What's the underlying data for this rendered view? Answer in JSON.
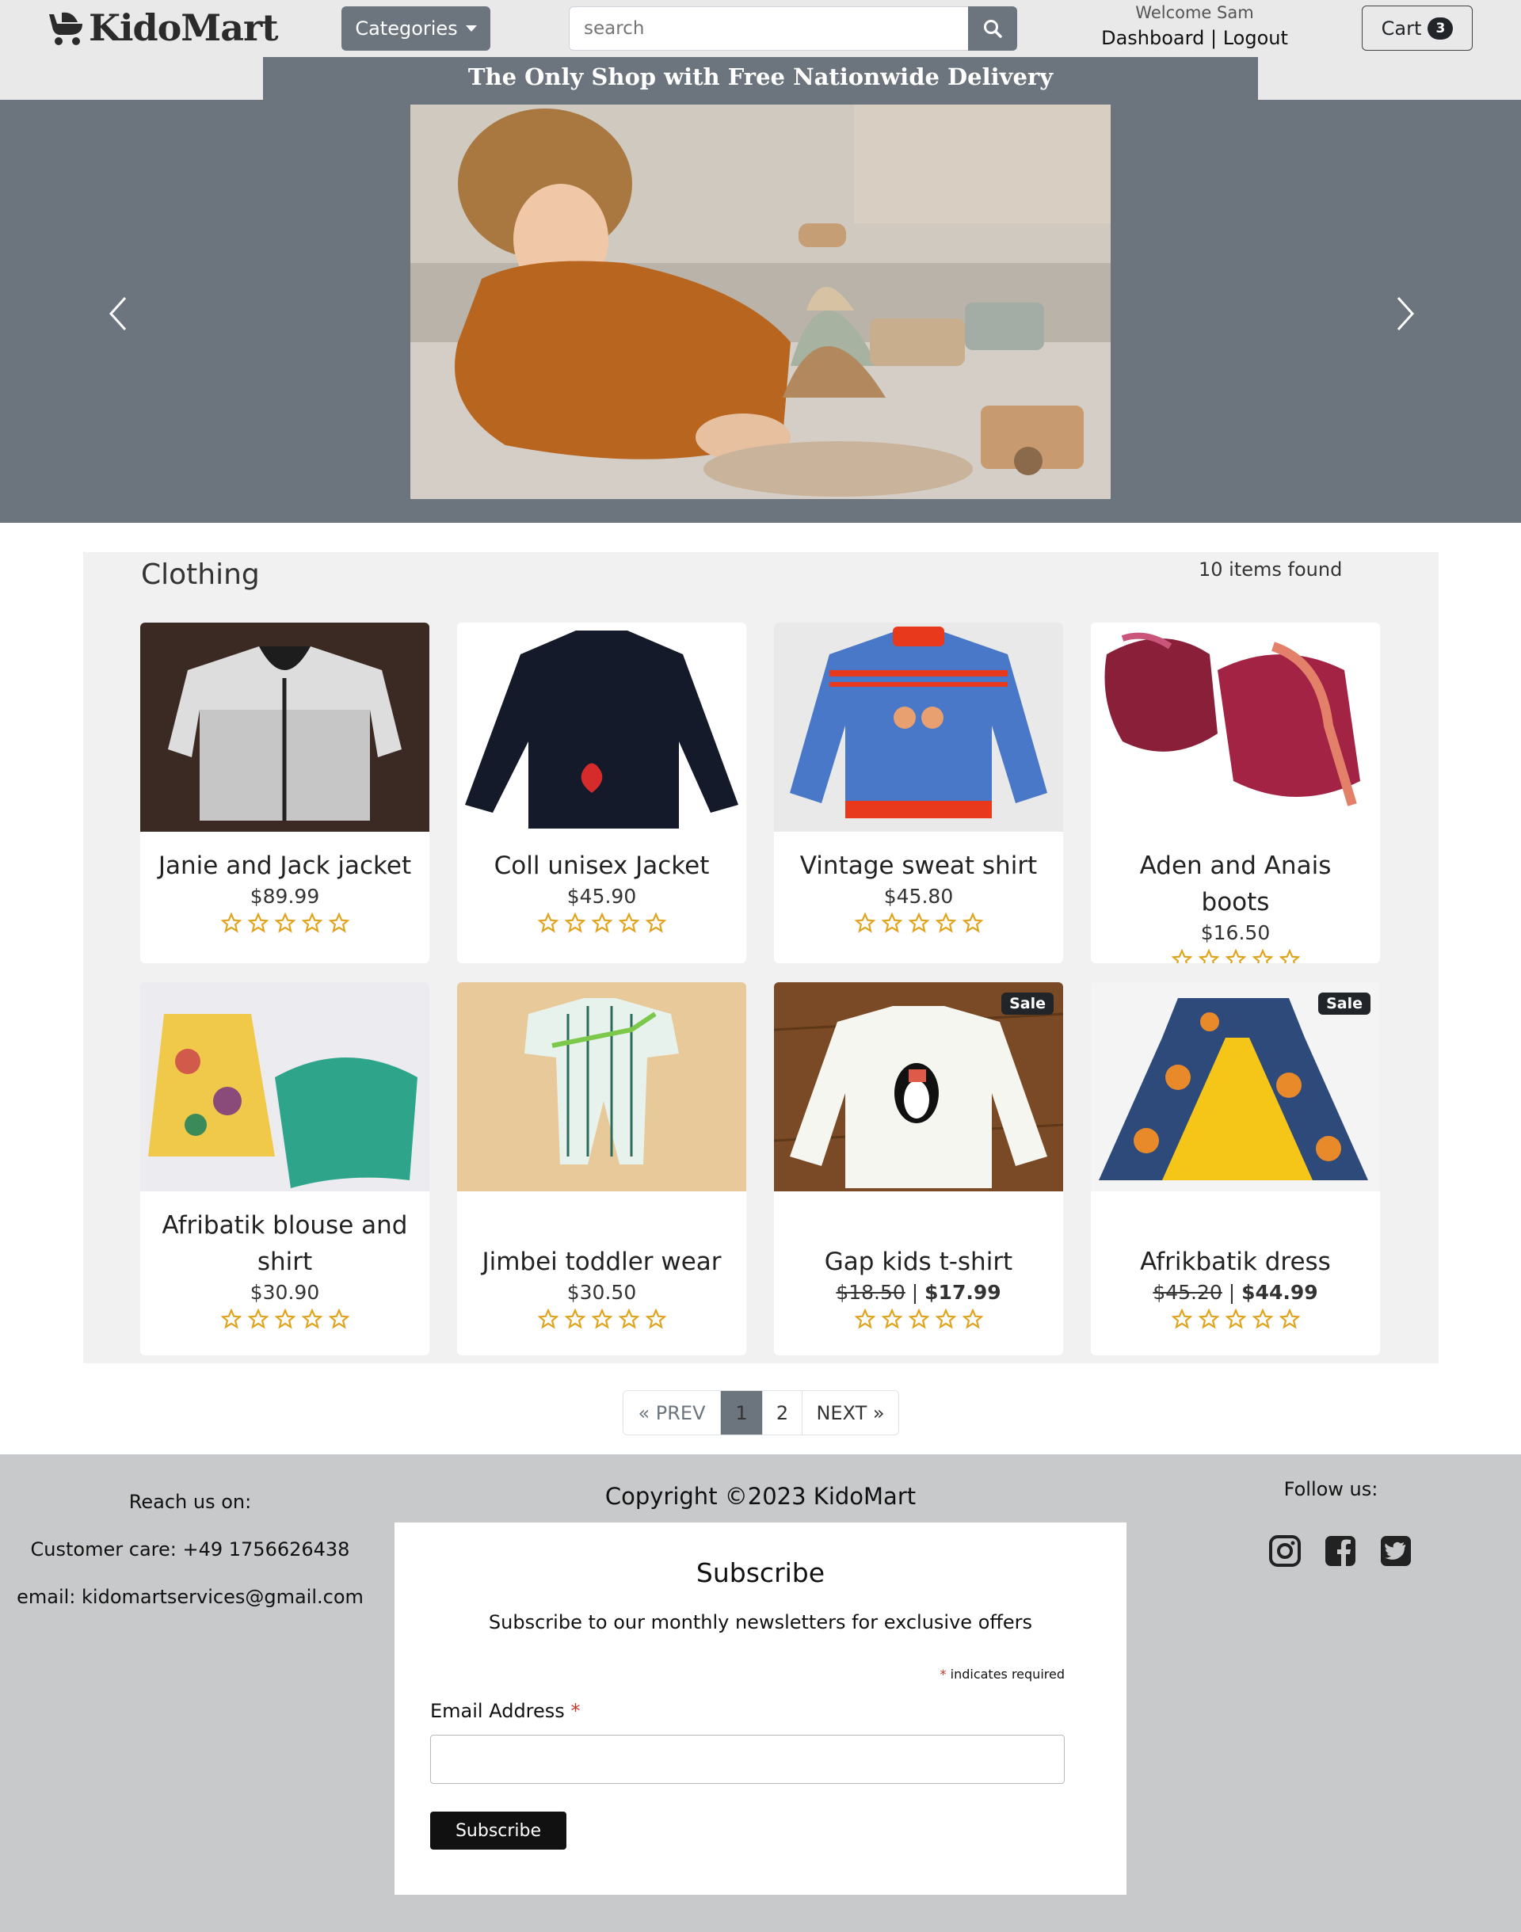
{
  "header": {
    "logo_text": "KidoMart",
    "categories_label": "Categories",
    "search_placeholder": "search",
    "welcome_text": "Welcome Sam",
    "dashboard_label": "Dashboard",
    "separator": "|",
    "logout_label": "Logout",
    "cart_label": "Cart",
    "cart_count": "3"
  },
  "banner": {
    "promo_text": "The Only Shop with Free Nationwide Delivery"
  },
  "section": {
    "title": "Clothing",
    "items_found": "10 items found"
  },
  "products": [
    {
      "name": "Janie and Jack jacket",
      "price": "$89.99",
      "old_price": "",
      "sale_price": "",
      "sale": false,
      "rating": 0
    },
    {
      "name": "Coll unisex Jacket",
      "price": "$45.90",
      "old_price": "",
      "sale_price": "",
      "sale": false,
      "rating": 0
    },
    {
      "name": "Vintage sweat shirt",
      "price": "$45.80",
      "old_price": "",
      "sale_price": "",
      "sale": false,
      "rating": 0
    },
    {
      "name": "Aden and Anais boots",
      "price": "$16.50",
      "old_price": "",
      "sale_price": "",
      "sale": false,
      "rating": 0
    },
    {
      "name": "Afribatik blouse and shirt",
      "price": "$30.90",
      "old_price": "",
      "sale_price": "",
      "sale": false,
      "rating": 0
    },
    {
      "name": "Jimbei toddler wear",
      "price": "$30.50",
      "old_price": "",
      "sale_price": "",
      "sale": false,
      "rating": 0
    },
    {
      "name": "Gap kids t-shirt",
      "price": "",
      "old_price": "$18.50",
      "sale_price": "$17.99",
      "sale": true,
      "rating": 0
    },
    {
      "name": "Afrikbatik dress",
      "price": "",
      "old_price": "$45.20",
      "sale_price": "$44.99",
      "sale": true,
      "rating": 0
    }
  ],
  "sale_badge": "Sale",
  "price_separator": " | ",
  "pagination": {
    "prev": "« PREV",
    "pages": [
      "1",
      "2"
    ],
    "current": "1",
    "next": "NEXT »"
  },
  "footer": {
    "reach_title": "Reach us on:",
    "customer_care": "Customer care: +49 1756626438",
    "email_label": "email:",
    "email": "kidomartservices@gmail.com",
    "copyright": "Copyright ©2023 KidoMart",
    "follow_title": "Follow us:",
    "social_icons": [
      "instagram-icon",
      "facebook-icon",
      "twitter-icon"
    ]
  },
  "subscribe": {
    "title": "Subscribe",
    "description": "Subscribe to our monthly newsletters for exclusive offers",
    "required_note": "indicates required",
    "email_label": "Email Address",
    "button_label": "Subscribe"
  },
  "colors": {
    "header_bg": "#e9e9e9",
    "accent_gray": "#6c757d",
    "star": "#e0a31c",
    "footer_bg": "#c8c9ca"
  }
}
